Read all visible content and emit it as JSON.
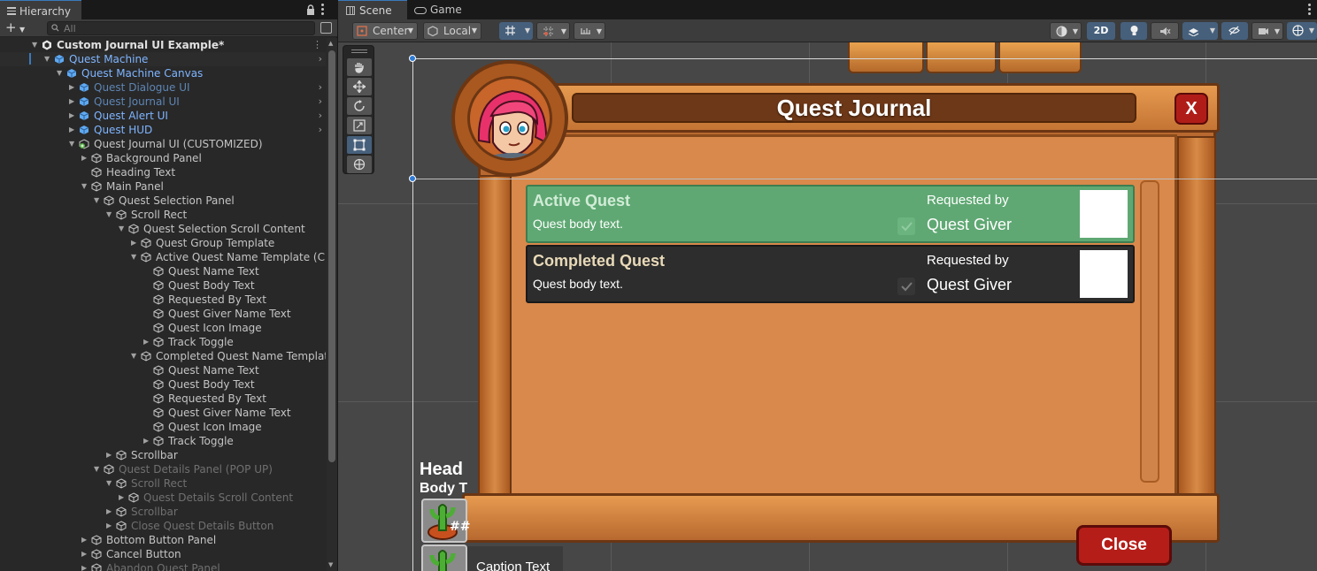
{
  "hierarchy": {
    "tab_label": "Hierarchy",
    "add_label": "+",
    "search_placeholder": "All",
    "rows": [
      {
        "label": "Custom Journal UI Example*"
      },
      {
        "label": "Quest Machine"
      },
      {
        "label": "Quest Machine Canvas"
      },
      {
        "label": "Quest Dialogue UI"
      },
      {
        "label": "Quest Journal UI"
      },
      {
        "label": "Quest Alert UI"
      },
      {
        "label": "Quest HUD"
      },
      {
        "label": "Quest Journal UI (CUSTOMIZED)"
      },
      {
        "label": "Background Panel"
      },
      {
        "label": "Heading Text"
      },
      {
        "label": "Main Panel"
      },
      {
        "label": "Quest Selection Panel"
      },
      {
        "label": "Scroll Rect"
      },
      {
        "label": "Quest Selection Scroll Content"
      },
      {
        "label": "Quest Group Template"
      },
      {
        "label": "Active Quest Name Template (CUS"
      },
      {
        "label": "Quest Name Text"
      },
      {
        "label": "Quest Body Text"
      },
      {
        "label": "Requested By Text"
      },
      {
        "label": "Quest Giver Name Text"
      },
      {
        "label": "Quest Icon Image"
      },
      {
        "label": "Track Toggle"
      },
      {
        "label": "Completed Quest Name Template"
      },
      {
        "label": "Quest Name Text"
      },
      {
        "label": "Quest Body Text"
      },
      {
        "label": "Requested By Text"
      },
      {
        "label": "Quest Giver Name Text"
      },
      {
        "label": "Quest Icon Image"
      },
      {
        "label": "Track Toggle"
      },
      {
        "label": "Scrollbar"
      },
      {
        "label": "Quest Details Panel (POP UP)"
      },
      {
        "label": "Scroll Rect"
      },
      {
        "label": "Quest Details Scroll Content"
      },
      {
        "label": "Scrollbar"
      },
      {
        "label": "Close Quest Details Button"
      },
      {
        "label": "Bottom Button Panel"
      },
      {
        "label": "Cancel Button"
      },
      {
        "label": "Abandon Quest Panel"
      }
    ]
  },
  "scene_tabs": {
    "scene": "Scene",
    "game": "Game"
  },
  "scene_toolbar": {
    "pivot": "Center",
    "space": "Local",
    "mode_2d": "2D"
  },
  "journal": {
    "title": "Quest Journal",
    "close_x": "X",
    "close_button": "Close",
    "quests": [
      {
        "name": "Active Quest",
        "body": "Quest body text.",
        "requested_by": "Requested by",
        "giver": "Quest Giver",
        "state": "active"
      },
      {
        "name": "Completed Quest",
        "body": "Quest body text.",
        "requested_by": "Requested by",
        "giver": "Quest Giver",
        "state": "completed"
      }
    ]
  },
  "orphan": {
    "heading": "Head",
    "body": "Body T",
    "slot_count": "##",
    "caption": "Caption Text"
  },
  "colors": {
    "selection_blue": "#3a79bb",
    "prefab_text": "#7fb5ff",
    "active_row": "#5fa873",
    "completed_row": "#2d2d2d",
    "close_red": "#b51d18"
  }
}
